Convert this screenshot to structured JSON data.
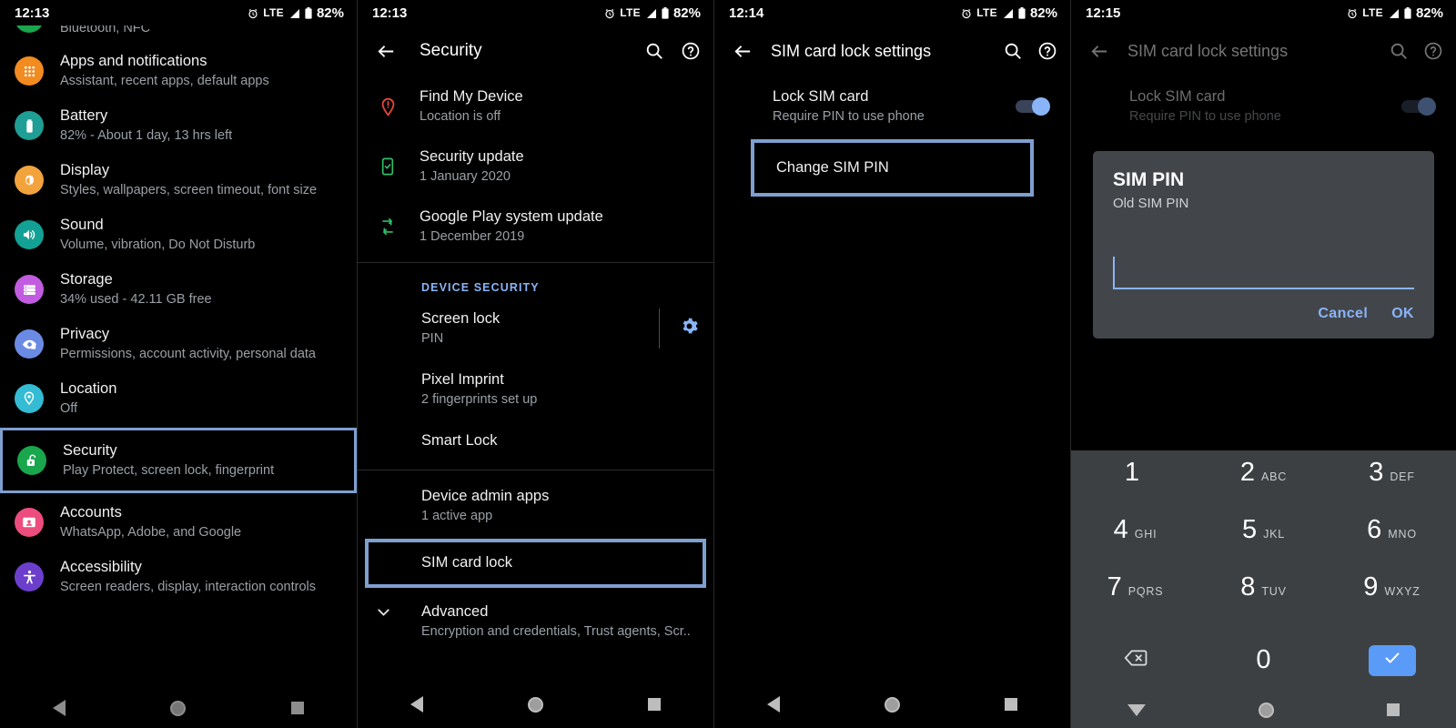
{
  "theme": {
    "accent_blue": "#8ab4f8",
    "highlight_box": "#7e9fd0",
    "dialog_bg": "#42464b",
    "keypad_bg": "#3c4043",
    "enter_key_blue": "#5b9bf8",
    "bg": "#000000",
    "secondary_text": "#9aa0a6"
  },
  "panel1": {
    "status": {
      "time": "12:13",
      "network": "LTE",
      "battery": "82%"
    },
    "cut_off_item": {
      "subtitle": "Bluetooth, NFC"
    },
    "items": [
      {
        "title": "Apps and notifications",
        "subtitle": "Assistant, recent apps, default apps",
        "icon": "apps-grid-icon",
        "color": "#f28b20"
      },
      {
        "title": "Battery",
        "subtitle": "82% - About 1 day, 13 hrs left",
        "icon": "battery-icon",
        "color": "#1e9e94"
      },
      {
        "title": "Display",
        "subtitle": "Styles, wallpapers, screen timeout, font size",
        "icon": "brightness-icon",
        "color": "#f2a33c"
      },
      {
        "title": "Sound",
        "subtitle": "Volume, vibration, Do Not Disturb",
        "icon": "speaker-icon",
        "color": "#13a195"
      },
      {
        "title": "Storage",
        "subtitle": "34% used - 42.11 GB free",
        "icon": "storage-icon",
        "color": "#c15ce0"
      },
      {
        "title": "Privacy",
        "subtitle": "Permissions, account activity, personal data",
        "icon": "eye-lock-icon",
        "color": "#6b8ae4"
      },
      {
        "title": "Location",
        "subtitle": "Off",
        "icon": "location-pin-icon",
        "color": "#33bcd4"
      },
      {
        "title": "Security",
        "subtitle": "Play Protect, screen lock, fingerprint",
        "icon": "unlock-icon",
        "color": "#19a64c",
        "highlighted": true
      },
      {
        "title": "Accounts",
        "subtitle": "WhatsApp, Adobe, and Google",
        "icon": "account-card-icon",
        "color": "#ec4d7e"
      },
      {
        "title": "Accessibility",
        "subtitle": "Screen readers, display, interaction controls",
        "icon": "accessibility-icon",
        "color": "#6b3fcc"
      }
    ]
  },
  "panel2": {
    "status": {
      "time": "12:13",
      "network": "LTE",
      "battery": "82%"
    },
    "appbar": {
      "title": "Security",
      "back": "back-arrow-icon",
      "search": "search-icon",
      "help": "help-icon"
    },
    "top_items": [
      {
        "title": "Find My Device",
        "subtitle": "Location is off",
        "icon": "find-device-icon",
        "color": "#e8453c"
      },
      {
        "title": "Security update",
        "subtitle": "1 January 2020",
        "icon": "phone-check-icon",
        "color": "#2ec06a"
      },
      {
        "title": "Google Play system update",
        "subtitle": "1 December 2019",
        "icon": "sync-update-icon",
        "color": "#2ec06a"
      }
    ],
    "section_label": "DEVICE SECURITY",
    "device_items": [
      {
        "title": "Screen lock",
        "subtitle": "PIN",
        "trailing": "gear-icon"
      },
      {
        "title": "Pixel Imprint",
        "subtitle": "2 fingerprints set up"
      },
      {
        "title": "Smart Lock",
        "subtitle": ""
      }
    ],
    "bottom_items": [
      {
        "title": "Device admin apps",
        "subtitle": "1 active app"
      },
      {
        "title": "SIM card lock",
        "subtitle": "",
        "highlighted": true
      },
      {
        "title": "Advanced",
        "subtitle": "Encryption and credentials, Trust agents, Scr..",
        "expand": "chevron-down-icon"
      }
    ]
  },
  "panel3": {
    "status": {
      "time": "12:14",
      "network": "LTE",
      "battery": "82%"
    },
    "appbar": {
      "title": "SIM card lock settings",
      "back": "back-arrow-icon",
      "search": "search-icon",
      "help": "help-icon"
    },
    "lock_sim": {
      "title": "Lock SIM card",
      "subtitle": "Require PIN to use phone",
      "toggle_on": true
    },
    "change_pin": {
      "title": "Change SIM PIN",
      "highlighted": true
    }
  },
  "panel4": {
    "status": {
      "time": "12:15",
      "network": "LTE",
      "battery": "82%"
    },
    "appbar": {
      "title": "SIM card lock settings",
      "back": "back-arrow-icon",
      "search": "search-icon",
      "help": "help-icon"
    },
    "lock_sim": {
      "title": "Lock SIM card",
      "subtitle": "Require PIN to use phone",
      "toggle_on": true
    },
    "dialog": {
      "title": "SIM PIN",
      "subtitle": "Old SIM PIN",
      "input_value": "",
      "cancel_label": "Cancel",
      "ok_label": "OK"
    },
    "keypad": {
      "keys": [
        {
          "num": "1",
          "abc": ""
        },
        {
          "num": "2",
          "abc": "ABC"
        },
        {
          "num": "3",
          "abc": "DEF"
        },
        {
          "num": "4",
          "abc": "GHI"
        },
        {
          "num": "5",
          "abc": "JKL"
        },
        {
          "num": "6",
          "abc": "MNO"
        },
        {
          "num": "7",
          "abc": "PQRS"
        },
        {
          "num": "8",
          "abc": "TUV"
        },
        {
          "num": "9",
          "abc": "WXYZ"
        }
      ],
      "backspace": "backspace-icon",
      "zero": "0",
      "enter": "checkmark-icon"
    }
  }
}
